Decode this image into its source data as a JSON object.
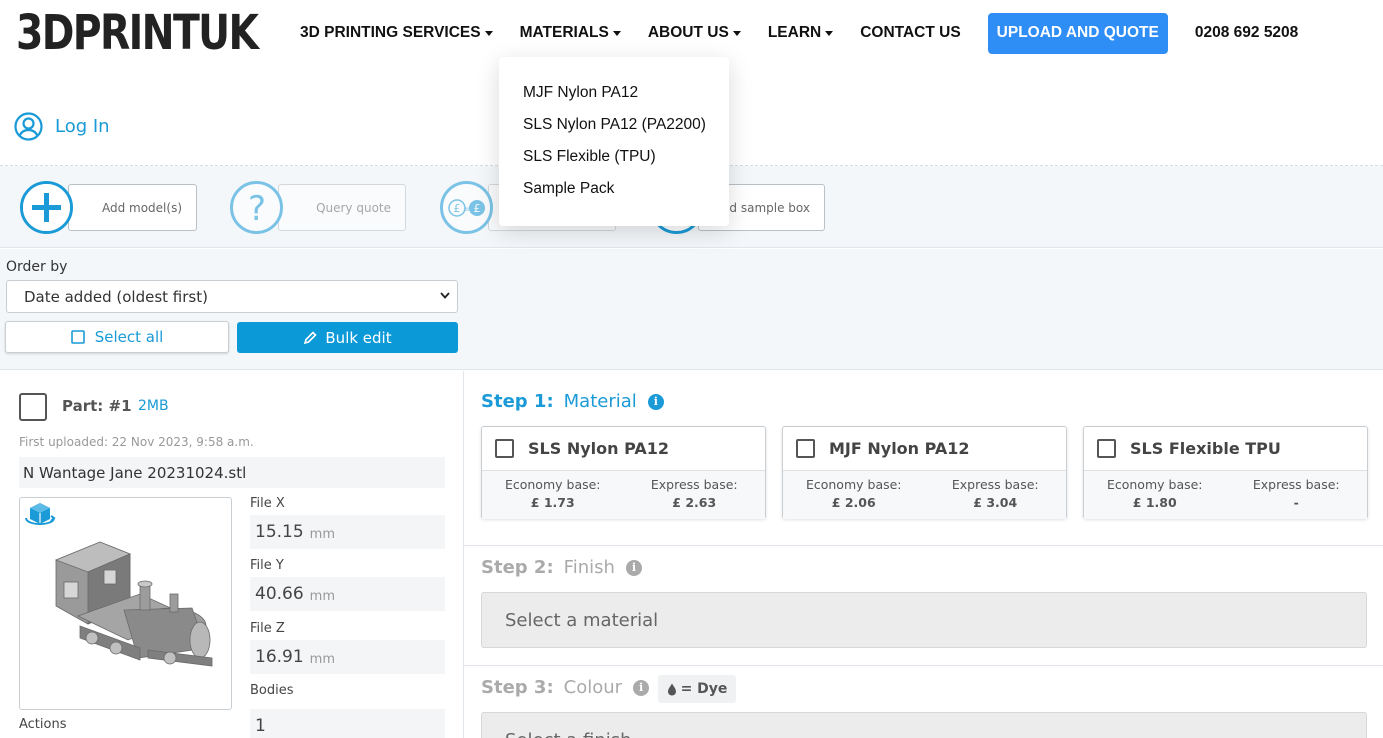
{
  "header": {
    "logo": "3DPRINTUK",
    "nav": {
      "services": "3D PRINTING SERVICES",
      "materials": "MATERIALS",
      "about": "ABOUT US",
      "learn": "LEARN",
      "contact": "CONTACT US",
      "upload": "UPLOAD AND QUOTE",
      "phone": "0208 692 5208"
    }
  },
  "materials_dropdown": {
    "items": [
      "MJF Nylon PA12",
      "SLS Nylon PA12 (PA2200)",
      "SLS Flexible (TPU)",
      "Sample Pack"
    ]
  },
  "login": {
    "label": "Log In"
  },
  "toolbar": {
    "add_models": "Add model(s)",
    "query_quote": "Query quote",
    "add_sample_box": "Add sample box"
  },
  "order": {
    "label": "Order by",
    "selected": "Date added (oldest first)",
    "select_all": "Select all",
    "bulk_edit": "Bulk edit"
  },
  "part": {
    "title": "Part: #1",
    "size": "2MB",
    "first_uploaded": "First uploaded: 22 Nov 2023, 9:58 a.m.",
    "filename": "N Wantage Jane 20231024.stl",
    "actions_label": "Actions",
    "unit": "mm",
    "file_x_label": "File X",
    "file_x": "15.15",
    "file_y_label": "File Y",
    "file_y": "40.66",
    "file_z_label": "File Z",
    "file_z": "16.91",
    "bodies_label": "Bodies",
    "bodies": "1"
  },
  "steps": {
    "step1": {
      "num": "Step 1:",
      "name": "Material"
    },
    "step2": {
      "num": "Step 2:",
      "name": "Finish",
      "placeholder": "Select a material"
    },
    "step3": {
      "num": "Step 3:",
      "name": "Colour",
      "badge": "= Dye",
      "placeholder": "Select a finish"
    }
  },
  "materials": [
    {
      "name": "SLS Nylon PA12",
      "economy_label": "Economy base:",
      "economy": "£ 1.73",
      "express_label": "Express base:",
      "express": "£ 2.63"
    },
    {
      "name": "MJF Nylon PA12",
      "economy_label": "Economy base:",
      "economy": "£ 2.06",
      "express_label": "Express base:",
      "express": "£ 3.04"
    },
    {
      "name": "SLS Flexible TPU",
      "economy_label": "Economy base:",
      "economy": "£ 1.80",
      "express_label": "Express base:",
      "express": "-"
    }
  ],
  "colors": {
    "accent": "#1a9ad6",
    "upload_button": "#2f8ef5",
    "bulk_button": "#0c99d8"
  }
}
